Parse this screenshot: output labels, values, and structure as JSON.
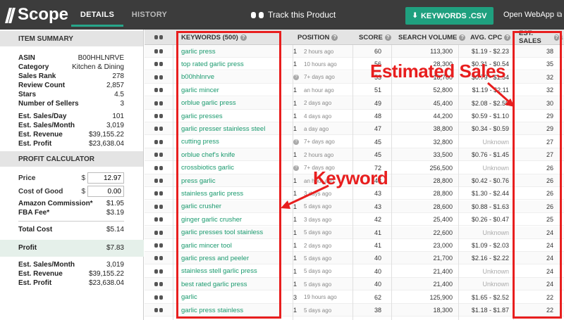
{
  "app": {
    "logo": "Scope"
  },
  "tabs": [
    {
      "label": "DETAILS"
    },
    {
      "label": "HISTORY"
    }
  ],
  "header": {
    "track_label": "Track this Product",
    "csv_label": "KEYWORDS .CSV",
    "open_webapp_label": "Open WebApp"
  },
  "item_summary": {
    "title": "ITEM SUMMARY",
    "rows": [
      {
        "label": "ASIN",
        "value": "B00HHLNRVE"
      },
      {
        "label": "Category",
        "value": "Kitchen & Dining"
      },
      {
        "label": "Sales Rank",
        "value": "278"
      },
      {
        "label": "Review Count",
        "value": "2,857"
      },
      {
        "label": "Stars",
        "value": "4.5"
      },
      {
        "label": "Number of Sellers",
        "value": "3"
      }
    ],
    "rows2": [
      {
        "label": "Est. Sales/Day",
        "value": "101"
      },
      {
        "label": "Est. Sales/Month",
        "value": "3,019"
      },
      {
        "label": "Est. Revenue",
        "value": "$39,155.22"
      },
      {
        "label": "Est. Profit",
        "value": "$23,638.04"
      }
    ]
  },
  "profit_calculator": {
    "title": "PROFIT CALCULATOR",
    "price_label": "Price",
    "price_currency": "$",
    "price_value": "12.97",
    "cog_label": "Cost of Good",
    "cog_currency": "$",
    "cog_value": "0.00",
    "commission_label": "Amazon Commission*",
    "commission_value": "$1.95",
    "fba_label": "FBA Fee*",
    "fba_value": "$3.19",
    "total_label": "Total Cost",
    "total_value": "$5.14",
    "profit_label": "Profit",
    "profit_value": "$7.83",
    "bottom": [
      {
        "label": "Est. Sales/Month",
        "value": "3,019"
      },
      {
        "label": "Est. Revenue",
        "value": "$39,155.22"
      },
      {
        "label": "Est. Profit",
        "value": "$23,638.04"
      }
    ]
  },
  "table": {
    "columns": {
      "keywords": "KEYWORDS (500)",
      "position": "POSITION",
      "score": "SCORE",
      "volume": "SEARCH VOLUME",
      "cpc": "AVG. CPC",
      "sales": "EST. SALES"
    },
    "rows": [
      {
        "kw": "garlic press",
        "pos": "1",
        "time": "2 hours ago",
        "score": "60",
        "vol": "113,300",
        "cpc": "$1.19 - $2.23",
        "sales": "38"
      },
      {
        "kw": "top rated garlic press",
        "pos": "1",
        "time": "10 hours ago",
        "score": "56",
        "vol": "28,300",
        "cpc": "$0.31 - $0.54",
        "sales": "35"
      },
      {
        "kw": "b00hhlnrve",
        "pos": "?",
        "time": "7+ days ago",
        "score": "53",
        "vol": "18,700",
        "cpc": "$0.79 - $1.54",
        "sales": "32"
      },
      {
        "kw": "garlic mincer",
        "pos": "1",
        "time": "an hour ago",
        "score": "51",
        "vol": "52,800",
        "cpc": "$1.19 - $2.11",
        "sales": "32"
      },
      {
        "kw": "orblue garlic press",
        "pos": "1",
        "time": "2 days ago",
        "score": "49",
        "vol": "45,400",
        "cpc": "$2.08 - $2.59",
        "sales": "30"
      },
      {
        "kw": "garlic presses",
        "pos": "1",
        "time": "4 days ago",
        "score": "48",
        "vol": "44,200",
        "cpc": "$0.59 - $1.10",
        "sales": "29"
      },
      {
        "kw": "garlic presser stainless steel",
        "pos": "1",
        "time": "a day ago",
        "score": "47",
        "vol": "38,800",
        "cpc": "$0.34 - $0.59",
        "sales": "29"
      },
      {
        "kw": "cutting press",
        "pos": "?",
        "time": "7+ days ago",
        "score": "45",
        "vol": "32,800",
        "cpc": "Unknown",
        "sales": "27"
      },
      {
        "kw": "orblue chef's knife",
        "pos": "1",
        "time": "2 hours ago",
        "score": "45",
        "vol": "33,500",
        "cpc": "$0.76 - $1.45",
        "sales": "27"
      },
      {
        "kw": "crossbiotics garlic",
        "pos": "?",
        "time": "7+ days ago",
        "score": "72",
        "vol": "256,500",
        "cpc": "Unknown",
        "sales": "26"
      },
      {
        "kw": "press garlic",
        "pos": "1",
        "time": "an hour ago",
        "score": "43",
        "vol": "28,800",
        "cpc": "$0.42 - $0.76",
        "sales": "26"
      },
      {
        "kw": "stainless garlic press",
        "pos": "1",
        "time": "3 days ago",
        "score": "43",
        "vol": "28,800",
        "cpc": "$1.30 - $2.44",
        "sales": "26"
      },
      {
        "kw": "garlic crusher",
        "pos": "1",
        "time": "5 days ago",
        "score": "43",
        "vol": "28,600",
        "cpc": "$0.88 - $1.63",
        "sales": "26"
      },
      {
        "kw": "ginger garlic crusher",
        "pos": "1",
        "time": "3 days ago",
        "score": "42",
        "vol": "25,400",
        "cpc": "$0.26 - $0.47",
        "sales": "25"
      },
      {
        "kw": "garlic presses tool stainless",
        "pos": "1",
        "time": "5 days ago",
        "score": "41",
        "vol": "22,600",
        "cpc": "Unknown",
        "sales": "24"
      },
      {
        "kw": "garlic mincer tool",
        "pos": "1",
        "time": "2 days ago",
        "score": "41",
        "vol": "23,000",
        "cpc": "$1.09 - $2.03",
        "sales": "24"
      },
      {
        "kw": "garlic press and peeler",
        "pos": "1",
        "time": "5 days ago",
        "score": "40",
        "vol": "21,700",
        "cpc": "$2.16 - $2.22",
        "sales": "24"
      },
      {
        "kw": "stainless stell garlic press",
        "pos": "1",
        "time": "5 days ago",
        "score": "40",
        "vol": "21,400",
        "cpc": "Unknown",
        "sales": "24"
      },
      {
        "kw": "best rated garlic press",
        "pos": "1",
        "time": "5 days ago",
        "score": "40",
        "vol": "21,400",
        "cpc": "Unknown",
        "sales": "24"
      },
      {
        "kw": "garlic",
        "pos": "3",
        "time": "19 hours ago",
        "score": "62",
        "vol": "125,900",
        "cpc": "$1.65 - $2.52",
        "sales": "22"
      },
      {
        "kw": "garlic press stainless",
        "pos": "1",
        "time": "5 days ago",
        "score": "38",
        "vol": "18,300",
        "cpc": "$1.18 - $1.87",
        "sales": "22"
      }
    ]
  },
  "annotations": {
    "sales": "Estimated Sales",
    "keyword": "Keyword"
  },
  "colors": {
    "accent": "#1fa07f",
    "annotation": "#e81e1e",
    "topbar": "#3c3c3c"
  }
}
